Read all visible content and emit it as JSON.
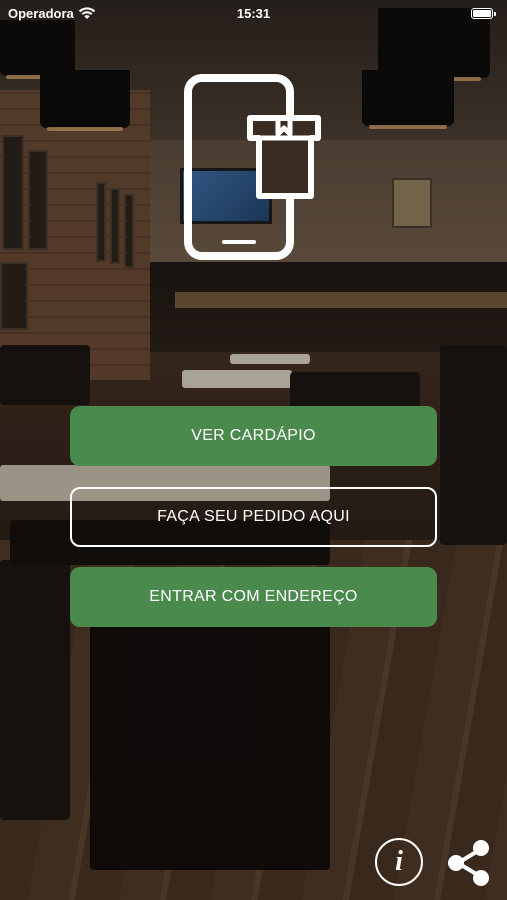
{
  "status_bar": {
    "carrier": "Operadora",
    "time": "15:31",
    "icons": [
      "wifi-icon",
      "battery-icon"
    ]
  },
  "logo": {
    "icon": "phone-with-takeout-bag-icon"
  },
  "buttons": {
    "menu_label": "VER CARDÁPIO",
    "order_label": "FAÇA SEU PEDIDO AQUI",
    "address_label": "ENTRAR COM ENDEREÇO"
  },
  "footer": {
    "info_label": "i",
    "icons": [
      "info-icon",
      "share-icon"
    ]
  },
  "colors": {
    "accent_green": "#4a8a4d",
    "text": "#ffffff"
  }
}
